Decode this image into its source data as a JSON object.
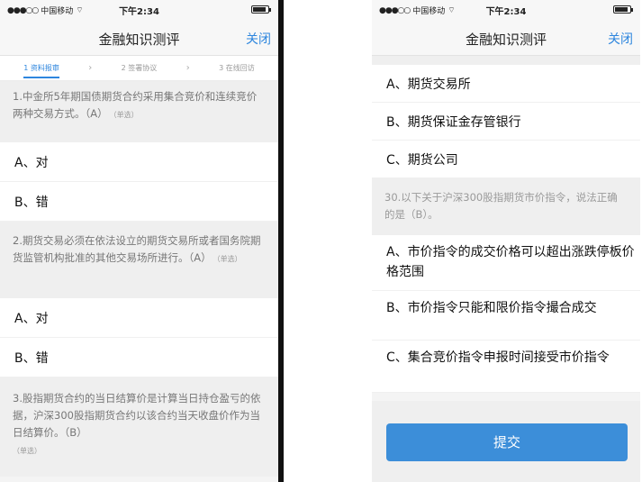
{
  "status_bar": {
    "carrier": "中国移动",
    "time": "下午2:34",
    "battery_level": 0.9
  },
  "left": {
    "title": "金融知识测评",
    "close_label": "关闭",
    "steps": [
      "1 资料报审",
      "2 签署协议",
      "3 在线回访"
    ],
    "questions": [
      {
        "text": "1.中金所5年期国债期货合约采用集合竞价和连续竞价两种交易方式。（A）",
        "tag": "（单选）",
        "options": [
          "A、对",
          "B、错"
        ]
      },
      {
        "text": "2.期货交易必须在依法设立的期货交易所或者国务院期货监管机构批准的其他交易场所进行。（A）",
        "tag": "（单选）",
        "options": [
          "A、对",
          "B、错"
        ]
      },
      {
        "text": "3.股指期货合约的当日结算价是计算当日持仓盈亏的依据，沪深300股指期货合约以该合约当天收盘价作为当日结算价。（B）",
        "tag": "（单选）",
        "options": []
      }
    ]
  },
  "right": {
    "title": "金融知识测评",
    "close_label": "关闭",
    "prev_options": [
      "A、期货交易所",
      "B、期货保证金存管银行",
      "C、期货公司"
    ],
    "question": {
      "text": "30.以下关于沪深300股指期货市价指令，说法正确的是（B）。",
      "tag": ""
    },
    "options": [
      "A、市价指令的成交价格可以超出涨跌停板价格范围",
      "B、市价指令只能和限价指令撮合成交",
      "C、集合竞价指令申报时间接受市价指令"
    ],
    "submit_label": "提交"
  }
}
